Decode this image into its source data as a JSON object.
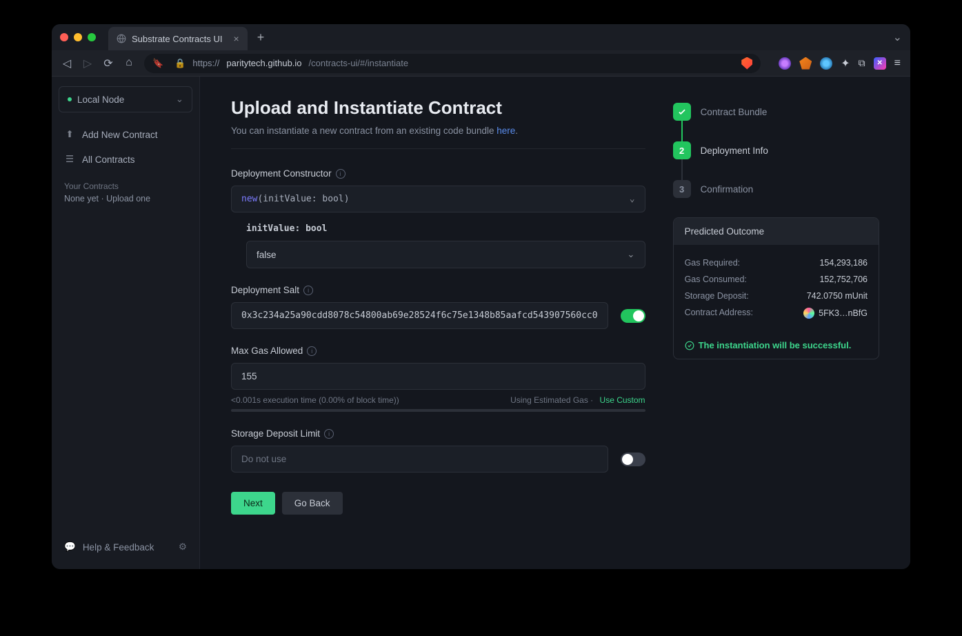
{
  "browser": {
    "tab_title": "Substrate Contracts UI",
    "url_prefix": "https://",
    "url_host": "paritytech.github.io",
    "url_path": "/contracts-ui/#/instantiate"
  },
  "sidebar": {
    "node": "Local Node",
    "add_new": "Add New Contract",
    "all_contracts": "All Contracts",
    "section": "Your Contracts",
    "empty": "None yet  ·  Upload one",
    "help": "Help & Feedback"
  },
  "page": {
    "title": "Upload and Instantiate Contract",
    "subtitle_pre": "You can instantiate a new contract from an existing code bundle ",
    "subtitle_link": "here",
    "subtitle_post": "."
  },
  "form": {
    "constructor_label": "Deployment Constructor",
    "constructor_kw": "new",
    "constructor_sig": "(initValue: bool)",
    "param_label": "initValue: bool",
    "param_value": "false",
    "salt_label": "Deployment Salt",
    "salt_value": "0x3c234a25a90cdd8078c54800ab69e28524f6c75e1348b85aafcd543907560cc0",
    "gas_label": "Max Gas Allowed",
    "gas_value": "155",
    "gas_meta_left": "<0.001s execution time (0.00% of block time))",
    "gas_meta_right": "Using Estimated Gas  ·",
    "gas_custom": "Use Custom",
    "deposit_label": "Storage Deposit Limit",
    "deposit_placeholder": "Do not use",
    "next": "Next",
    "back": "Go Back"
  },
  "steps": {
    "s1": "Contract Bundle",
    "s2": "Deployment Info",
    "s3": "Confirmation",
    "n2": "2",
    "n3": "3"
  },
  "outcome": {
    "title": "Predicted Outcome",
    "gas_required_k": "Gas Required:",
    "gas_required_v": "154,293,186",
    "gas_consumed_k": "Gas Consumed:",
    "gas_consumed_v": "152,752,706",
    "storage_k": "Storage Deposit:",
    "storage_v": "742.0750 mUnit",
    "addr_k": "Contract Address:",
    "addr_v": "5FK3…nBfG",
    "success": "The instantiation will be successful."
  }
}
